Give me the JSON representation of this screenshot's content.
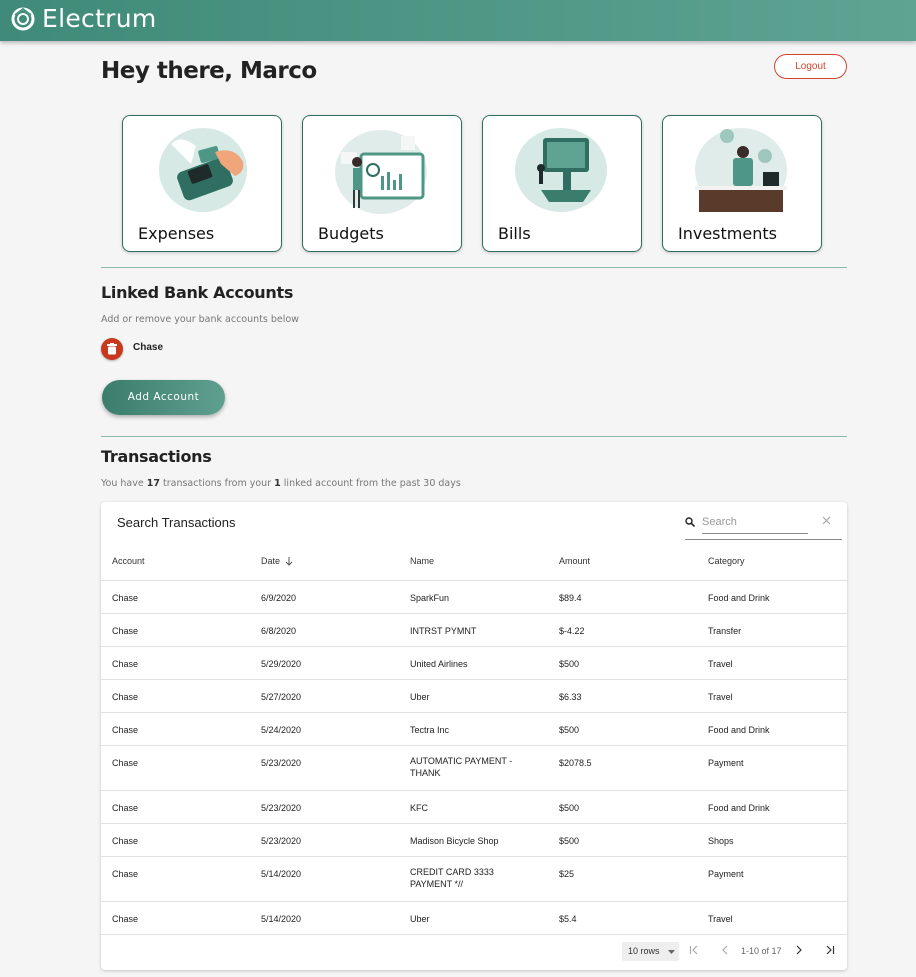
{
  "app": {
    "brand": "Electrum"
  },
  "header": {
    "greeting": "Hey there, Marco",
    "logout_label": "Logout"
  },
  "cards": [
    {
      "label": "Expenses",
      "icon": "payment-terminal-illustration"
    },
    {
      "label": "Budgets",
      "icon": "chart-board-illustration"
    },
    {
      "label": "Bills",
      "icon": "computer-illustration"
    },
    {
      "label": "Investments",
      "icon": "investor-desk-illustration"
    }
  ],
  "linked": {
    "title": "Linked Bank Accounts",
    "subtitle": "Add or remove your bank accounts below",
    "accounts": [
      {
        "name": "Chase"
      }
    ],
    "add_label": "Add Account"
  },
  "transactions": {
    "title": "Transactions",
    "summary_prefix": "You have ",
    "count": "17",
    "summary_mid": " transactions from your ",
    "linked_count": "1",
    "summary_suffix": " linked account from the past 30 days",
    "panel_title": "Search Transactions",
    "search_placeholder": "Search",
    "columns": [
      "Account",
      "Date",
      "Name",
      "Amount",
      "Category"
    ],
    "rows": [
      {
        "account": "Chase",
        "date": "6/9/2020",
        "name": "SparkFun",
        "amount": "$89.4",
        "category": "Food and Drink"
      },
      {
        "account": "Chase",
        "date": "6/8/2020",
        "name": "INTRST PYMNT",
        "amount": "$-4.22",
        "category": "Transfer"
      },
      {
        "account": "Chase",
        "date": "5/29/2020",
        "name": "United Airlines",
        "amount": "$500",
        "category": "Travel"
      },
      {
        "account": "Chase",
        "date": "5/27/2020",
        "name": "Uber",
        "amount": "$6.33",
        "category": "Travel"
      },
      {
        "account": "Chase",
        "date": "5/24/2020",
        "name": "Tectra Inc",
        "amount": "$500",
        "category": "Food and Drink"
      },
      {
        "account": "Chase",
        "date": "5/23/2020",
        "name": "AUTOMATIC PAYMENT - THANK",
        "amount": "$2078.5",
        "category": "Payment"
      },
      {
        "account": "Chase",
        "date": "5/23/2020",
        "name": "KFC",
        "amount": "$500",
        "category": "Food and Drink"
      },
      {
        "account": "Chase",
        "date": "5/23/2020",
        "name": "Madison Bicycle Shop",
        "amount": "$500",
        "category": "Shops"
      },
      {
        "account": "Chase",
        "date": "5/14/2020",
        "name": "CREDIT CARD 3333 PAYMENT *//",
        "amount": "$25",
        "category": "Payment"
      },
      {
        "account": "Chase",
        "date": "5/14/2020",
        "name": "Uber",
        "amount": "$5.4",
        "category": "Travel"
      }
    ],
    "pagination": {
      "rows_per_page": "10 rows",
      "range": "1-10 of 17"
    }
  },
  "colors": {
    "brand": "#4e9786",
    "danger": "#d2452c",
    "accent_dark": "#3b7d6c"
  }
}
